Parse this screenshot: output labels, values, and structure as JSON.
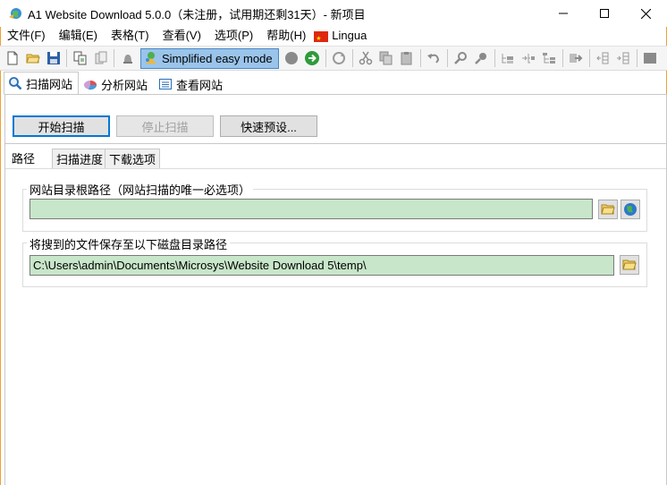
{
  "window": {
    "title": "A1 Website Download 5.0.0（未注册，试用期还剩31天）- 新项目",
    "controls": [
      "minimize",
      "maximize",
      "close"
    ]
  },
  "menu": {
    "items": [
      "文件(F)",
      "编辑(E)",
      "表格(T)",
      "查看(V)",
      "选项(P)",
      "帮助(H)"
    ],
    "lingua_label": "Lingua"
  },
  "toolbar": {
    "mode_label": "Simplified easy mode"
  },
  "main_tabs": [
    "扫描网站",
    "分析网站",
    "查看网站"
  ],
  "scan_panel": {
    "start_label": "开始扫描",
    "stop_label": "停止扫描",
    "preset_label": "快速预设..."
  },
  "sub_tabs": [
    "路径",
    "扫描进度",
    "下载选项"
  ],
  "root_group": {
    "label": "网站目录根路径（网站扫描的唯一必选项）",
    "value": ""
  },
  "save_group": {
    "label": "将搜到的文件保存至以下磁盘目录路径",
    "value": "C:\\Users\\admin\\Documents\\Microsys\\Website Download 5\\temp\\"
  },
  "colors": {
    "field_bg": "#c8e6c9",
    "mode_highlight": "#9ac4ea",
    "window_border": "#f0a030"
  }
}
